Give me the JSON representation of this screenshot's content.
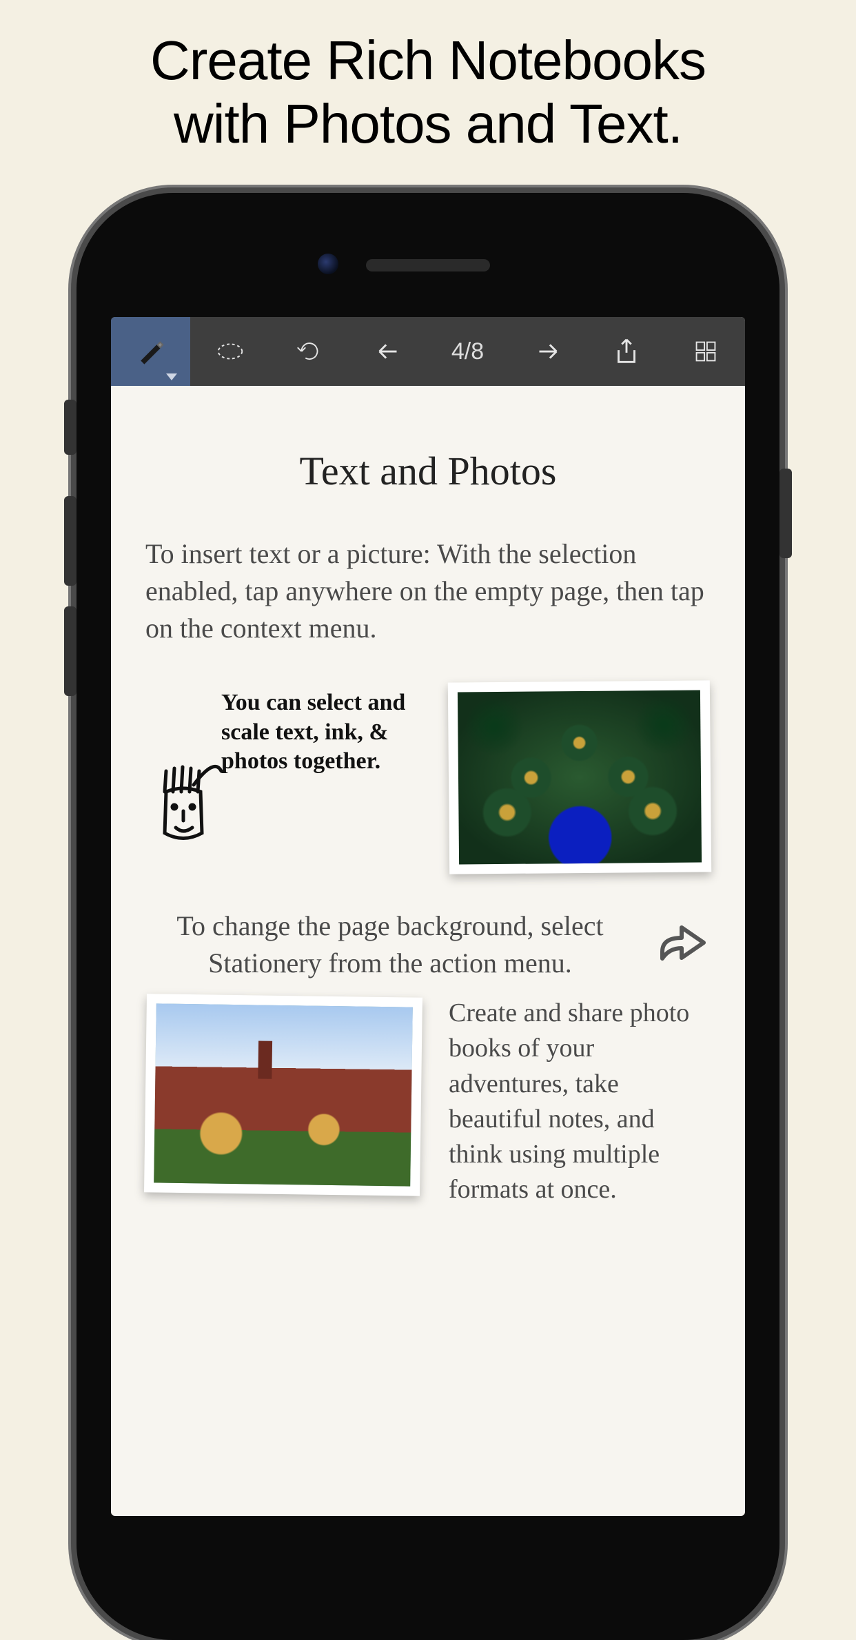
{
  "marketing": {
    "headline_line1": "Create Rich Notebooks",
    "headline_line2": "with Photos and Text."
  },
  "toolbar": {
    "pen_icon": "pen-icon",
    "lasso_icon": "lasso-icon",
    "undo_icon": "undo-icon",
    "prev_icon": "arrow-left-icon",
    "page_counter": "4/8",
    "next_icon": "arrow-right-icon",
    "share_icon": "share-icon",
    "grid_icon": "grid-icon"
  },
  "page": {
    "title": "Text and Photos",
    "intro": "To insert text or a picture: With the selection enabled, tap anywhere on the empty page, then tap on the context menu.",
    "handwritten": "You can select and scale text, ink, & photos together.",
    "background_tip": "To change the page background, select Stationery from the action menu.",
    "photobook_text": "Create and share photo books of your adventures, take beautiful notes, and think using multiple formats at once.",
    "photo1_alt": "peacock photo",
    "photo2_alt": "castle photo"
  }
}
